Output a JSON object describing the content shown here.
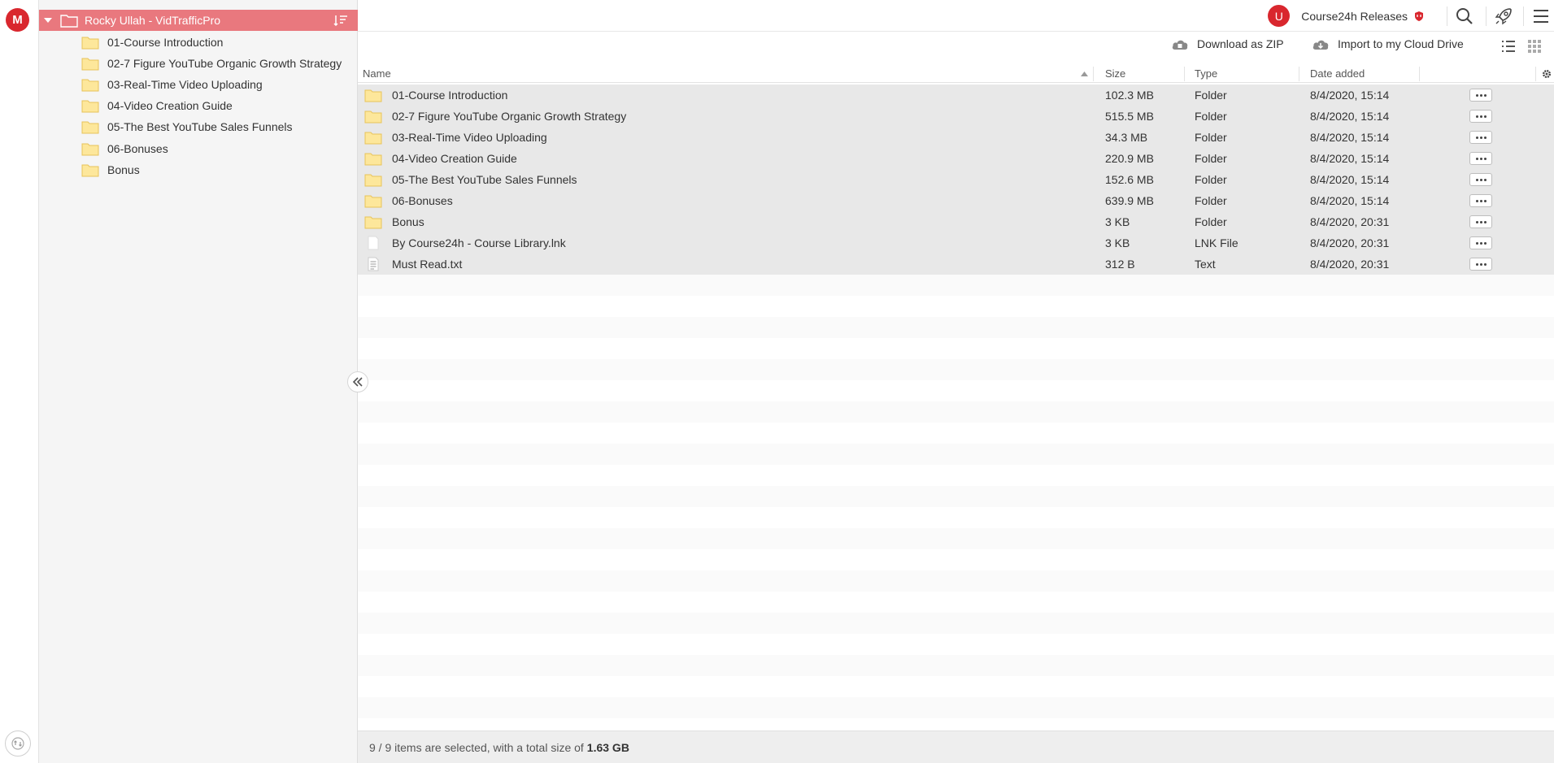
{
  "rail": {
    "logo": "M",
    "logo_color": "#d9272e"
  },
  "sidebar": {
    "root_label": "Rocky Ullah - VidTrafficPro",
    "root_bg": "#e9787e",
    "items": [
      {
        "label": "01-Course Introduction"
      },
      {
        "label": "02-7 Figure YouTube Organic Growth Strategy"
      },
      {
        "label": "03-Real-Time Video Uploading"
      },
      {
        "label": "04-Video Creation Guide"
      },
      {
        "label": "05-The Best YouTube Sales Funnels"
      },
      {
        "label": "06-Bonuses"
      },
      {
        "label": "Bonus"
      }
    ]
  },
  "topbar": {
    "avatar_letter": "U",
    "account_name": "Course24h Releases",
    "icons": [
      "search-icon",
      "rocket-icon",
      "hamburger-menu-icon"
    ]
  },
  "actions": {
    "download_zip": "Download as ZIP",
    "import_drive": "Import to my Cloud Drive"
  },
  "table": {
    "headers": {
      "name": "Name",
      "size": "Size",
      "type": "Type",
      "date": "Date added"
    },
    "rows": [
      {
        "name": "01-Course Introduction",
        "size": "102.3 MB",
        "type": "Folder",
        "date": "8/4/2020, 15:14",
        "icon": "folder-icon"
      },
      {
        "name": "02-7 Figure YouTube Organic Growth Strategy",
        "size": "515.5 MB",
        "type": "Folder",
        "date": "8/4/2020, 15:14",
        "icon": "folder-icon"
      },
      {
        "name": "03-Real-Time Video Uploading",
        "size": "34.3 MB",
        "type": "Folder",
        "date": "8/4/2020, 15:14",
        "icon": "folder-icon"
      },
      {
        "name": "04-Video Creation Guide",
        "size": "220.9 MB",
        "type": "Folder",
        "date": "8/4/2020, 15:14",
        "icon": "folder-icon"
      },
      {
        "name": "05-The Best YouTube Sales Funnels",
        "size": "152.6 MB",
        "type": "Folder",
        "date": "8/4/2020, 15:14",
        "icon": "folder-icon"
      },
      {
        "name": "06-Bonuses",
        "size": "639.9 MB",
        "type": "Folder",
        "date": "8/4/2020, 15:14",
        "icon": "folder-icon"
      },
      {
        "name": "Bonus",
        "size": "3 KB",
        "type": "Folder",
        "date": "8/4/2020, 20:31",
        "icon": "folder-icon"
      },
      {
        "name": "By Course24h - Course Library.lnk",
        "size": "3 KB",
        "type": "LNK File",
        "date": "8/4/2020, 20:31",
        "icon": "blank-file-icon"
      },
      {
        "name": "Must Read.txt",
        "size": "312 B",
        "type": "Text",
        "date": "8/4/2020, 20:31",
        "icon": "text-file-icon"
      }
    ]
  },
  "footer": {
    "selection_text": "9 / 9 items are selected, with a total size of",
    "total_size": "1.63 GB"
  }
}
